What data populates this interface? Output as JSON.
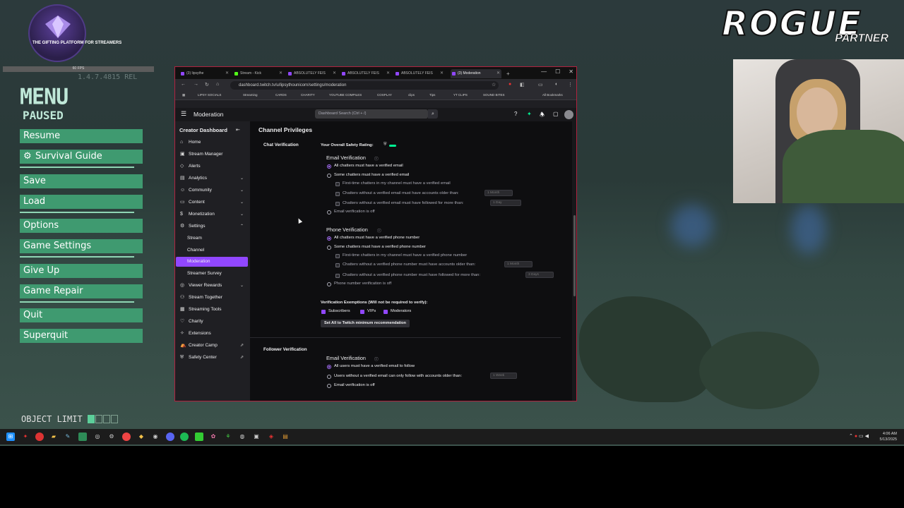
{
  "logo": {
    "text": "THE GIFTING PLATFORM FOR STREAMERS"
  },
  "rogue": {
    "title": "ROGUE",
    "subtitle": "PARTNER"
  },
  "hud": {
    "small": "60 FPS",
    "version": "1.4.7.4815 REL"
  },
  "menu": {
    "title": "MENU",
    "paused": "PAUSED",
    "items": [
      {
        "label": "Resume"
      },
      {
        "label": "Survival Guide",
        "icon": "gear-icon"
      },
      {
        "label": "Save"
      },
      {
        "label": "Load"
      },
      {
        "label": "Options"
      },
      {
        "label": "Game Settings"
      },
      {
        "label": "Give Up"
      },
      {
        "label": "Game Repair"
      },
      {
        "label": "Quit"
      },
      {
        "label": "Superquit"
      }
    ],
    "object_limit": "OBJECT LIMIT",
    "object_limit_fill": 1,
    "object_limit_total": 4
  },
  "browser": {
    "tabs": [
      {
        "label": "(3) lipsythe",
        "color": "#9147ff"
      },
      {
        "label": "Stream - Kick",
        "color": "#53fc18"
      },
      {
        "label": "ABSOLUTELY FEIS",
        "color": "#9147ff"
      },
      {
        "label": "ABSOLUTELY FEIS",
        "color": "#9147ff"
      },
      {
        "label": "ABSOLUTELY FEIS",
        "color": "#9147ff"
      },
      {
        "label": "(3) Moderation",
        "color": "#9147ff"
      }
    ],
    "url": "dashboard.twitch.tv/u/lipsythounicorn/settings/moderation",
    "bookmarks": [
      "LIPSY SOCIALS",
      "Streaming",
      "CARDS",
      "CHARITY",
      "YOUTUBE COMPILES",
      "COSPLAY",
      "clips",
      "Tips",
      "YT CLIPS",
      "SOUND BITES",
      "All Bookmarks"
    ]
  },
  "twitch": {
    "page_title": "Moderation",
    "search_placeholder": "Dashboard Search (Ctrl + /)",
    "sidebar": {
      "title": "Creator Dashboard",
      "items": [
        {
          "label": "Home",
          "icon": "home-icon"
        },
        {
          "label": "Stream Manager",
          "icon": "stream-manager-icon"
        },
        {
          "label": "Alerts",
          "icon": "alerts-icon"
        },
        {
          "label": "Analytics",
          "icon": "analytics-icon"
        },
        {
          "label": "Community",
          "icon": "community-icon"
        },
        {
          "label": "Content",
          "icon": "content-icon"
        },
        {
          "label": "Monetization",
          "icon": "monetization-icon"
        },
        {
          "label": "Settings",
          "icon": "settings-icon"
        },
        {
          "label": "Stream"
        },
        {
          "label": "Channel"
        },
        {
          "label": "Moderation"
        },
        {
          "label": "Streamer Survey"
        },
        {
          "label": "Viewer Rewards",
          "icon": "viewer-rewards-icon"
        },
        {
          "label": "Stream Together",
          "icon": "stream-together-icon"
        },
        {
          "label": "Streaming Tools",
          "icon": "streaming-tools-icon"
        },
        {
          "label": "Charity",
          "icon": "charity-icon"
        },
        {
          "label": "Extensions",
          "icon": "extensions-icon"
        },
        {
          "label": "Creator Camp",
          "icon": "creator-camp-icon"
        },
        {
          "label": "Safety Center",
          "icon": "safety-center-icon"
        }
      ]
    },
    "main": {
      "title": "Channel Privileges",
      "chat_verification": {
        "label": "Chat Verification",
        "rating_label": "Your Overall Safety Rating:",
        "email": {
          "heading": "Email Verification",
          "all": "All chatters must have a verified email",
          "some": "Some chatters must have a verified email",
          "first_time": "First-time chatters in my channel must have a verified email",
          "older_than": "Chatters without a verified email must have accounts older than:",
          "older_value": "1 Month",
          "followed": "Chatters without a verified email must have followed for more than:",
          "followed_value": "1 Day",
          "off": "Email verification is off"
        },
        "phone": {
          "heading": "Phone Verification",
          "all": "All chatters must have a verified phone number",
          "some": "Some chatters must have a verified phone number",
          "first_time": "First-time chatters in my channel must have a verified phone number",
          "older_than": "Chatters without a verified phone number must have accounts older than:",
          "older_value": "1 Month",
          "followed": "Chatters without a verified phone number must have followed for more than:",
          "followed_value": "3 Days",
          "off": "Phone number verification is off"
        },
        "exemptions": {
          "heading": "Verification Exemptions (Will not be required to verify):",
          "subscribers": "Subscribers",
          "vips": "VIPs",
          "moderators": "Moderators"
        },
        "set_button": "Set All to Twitch minimum recommendation"
      },
      "follower_verification": {
        "label": "Follower Verification",
        "heading": "Email Verification",
        "all": "All users must have a verified email to follow",
        "older": "Users without a verified email can only follow with accounts older than:",
        "older_value": "1 Week",
        "off": "Email verification is off"
      }
    }
  },
  "clock": {
    "time": "4:06 AM",
    "date": "5/13/2025"
  }
}
